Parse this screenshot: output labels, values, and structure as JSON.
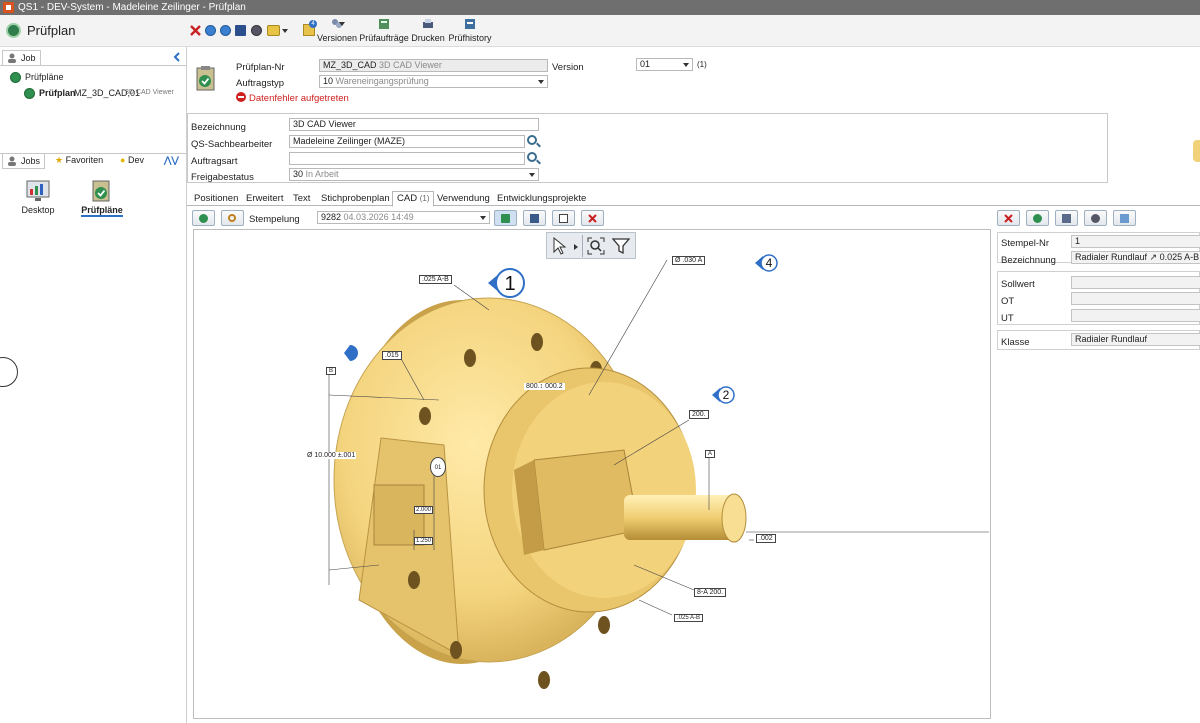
{
  "window": {
    "title": "QS1 - DEV-System - Madeleine Zeilinger - Prüfplan"
  },
  "module": {
    "title": "Prüfplan"
  },
  "toolbar": {
    "versionen": "Versionen",
    "pruefauftraege": "Prüfaufträge",
    "drucken": "Drucken",
    "pruefhistory": "Prüfhistory",
    "badge": "4"
  },
  "left": {
    "tab_job": "Job",
    "tree_root": "Prüfpläne",
    "tree_item_bold": "Prüfplan",
    "tree_item_id": "MZ_3D_CAD,01",
    "tree_item_desc": "3D CAD Viewer",
    "tabs": [
      "Jobs",
      "Favoriten",
      "Dev"
    ],
    "tiles": [
      {
        "label": "Desktop"
      },
      {
        "label": "Prüfpläne"
      }
    ]
  },
  "header": {
    "pruefplan_nr_label": "Prüfplan-Nr",
    "pruefplan_nr_value": "MZ_3D_CAD",
    "pruefplan_nr_sub": "3D CAD Viewer",
    "version_label": "Version",
    "version_value": "01",
    "version_count": "(1)",
    "auftragstyp_label": "Auftragstyp",
    "auftragstyp_code": "10",
    "auftragstyp_value": "Wareneingangsprüfung",
    "error_text": "Datenfehler aufgetreten"
  },
  "form": {
    "bezeichnung_label": "Bezeichnung",
    "bezeichnung_value": "3D CAD Viewer",
    "qs_label": "QS-Sachbearbeiter",
    "qs_value": "Madeleine Zeilinger (MAZE)",
    "auftragsart_label": "Auftragsart",
    "auftragsart_value": "",
    "freigabe_label": "Freigabestatus",
    "freigabe_code": "30",
    "freigabe_value": "In Arbeit"
  },
  "tabs": [
    {
      "label": "Positionen"
    },
    {
      "label": "Erweitert"
    },
    {
      "label": "Text"
    },
    {
      "label": "Stichprobenplan"
    },
    {
      "label": "CAD",
      "count": "(1)"
    },
    {
      "label": "Verwendung"
    },
    {
      "label": "Entwicklungsprojekte"
    }
  ],
  "stamp": {
    "label": "Stempelung",
    "value": "9282",
    "date": "04.03.2026 14:49"
  },
  "props": {
    "stempel_nr_label": "Stempel-Nr",
    "stempel_nr_value": "1",
    "bezeichnung_label": "Bezeichnung",
    "bezeichnung_value": "Radialer Rundlauf ↗ 0.025 A-B -",
    "sollwert_label": "Sollwert",
    "ot_label": "OT",
    "ut_label": "UT",
    "klasse_label": "Klasse",
    "klasse_value": "Radialer Rundlauf"
  },
  "cad": {
    "balloons": [
      "1",
      "2",
      "4"
    ],
    "dims": {
      "fcf_top": ".025 A-B",
      "fcf_015": ".015",
      "fcf_030": "Ø .030 A",
      "dim_800": "800.↕ 000.2",
      "dim_200": "200.",
      "dia_10": "Ø 10.000 ±.001",
      "dim_2000": "2.000",
      "dim_1250": "1.250",
      "ref_01": "01",
      "circ_002": ".002",
      "fcf_200ab": "8-A 200.",
      "fcf_025b": ".025 A-B",
      "datum_a": "A",
      "datum_b": "B"
    }
  }
}
